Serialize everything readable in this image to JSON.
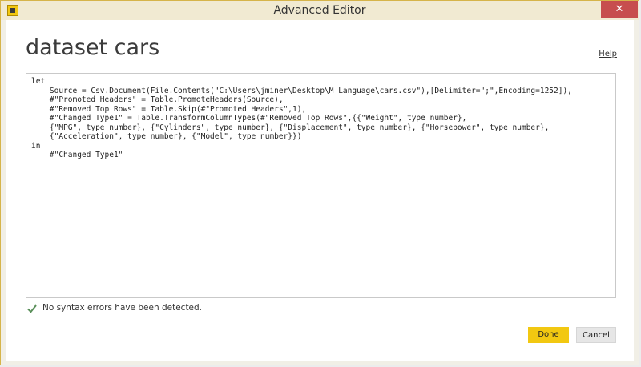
{
  "window": {
    "title": "Advanced Editor",
    "close_label": "✕"
  },
  "dialog": {
    "heading": "dataset cars",
    "help_label": "Help"
  },
  "editor": {
    "lines": [
      "let",
      "    Source = Csv.Document(File.Contents(\"C:\\Users\\jminer\\Desktop\\M Language\\cars.csv\"),[Delimiter=\";\",Encoding=1252]),",
      "    #\"Promoted Headers\" = Table.PromoteHeaders(Source),",
      "    #\"Removed Top Rows\" = Table.Skip(#\"Promoted Headers\",1),",
      "    #\"Changed Type1\" = Table.TransformColumnTypes(#\"Removed Top Rows\",{{\"Weight\", type number},",
      "    {\"MPG\", type number}, {\"Cylinders\", type number}, {\"Displacement\", type number}, {\"Horsepower\", type number},",
      "    {\"Acceleration\", type number}, {\"Model\", type number}})",
      "in",
      "    #\"Changed Type1\""
    ]
  },
  "status": {
    "message": "No syntax errors have been detected.",
    "icon": "check-icon",
    "color": "#5a8f5a"
  },
  "buttons": {
    "done_label": "Done",
    "cancel_label": "Cancel"
  },
  "colors": {
    "accent": "#f2c811",
    "close": "#c74e4e"
  }
}
